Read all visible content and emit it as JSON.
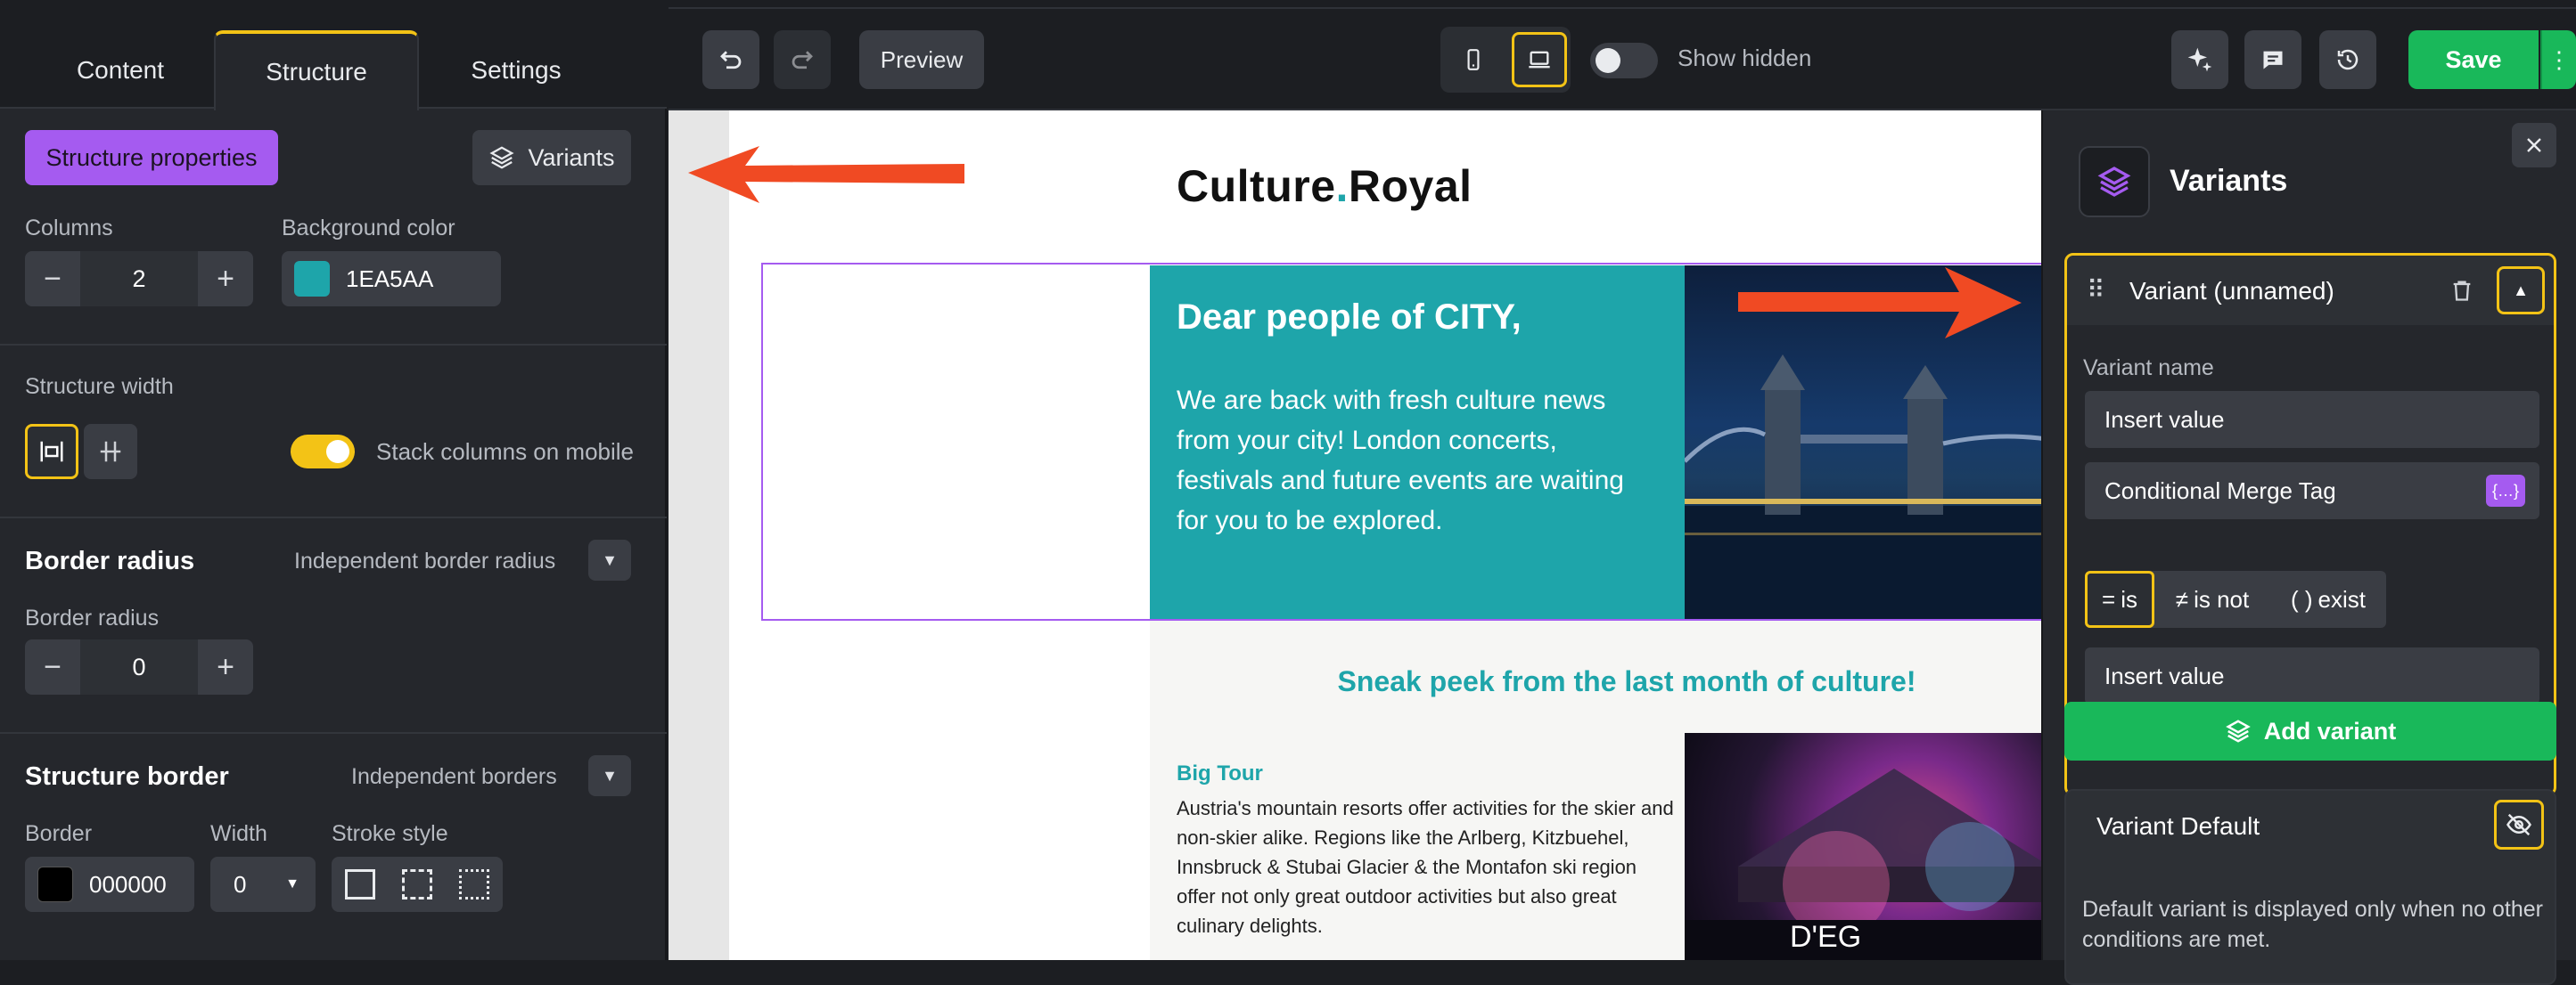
{
  "left_panel": {
    "tabs": [
      "Content",
      "Structure",
      "Settings"
    ],
    "structure_properties_label": "Structure properties",
    "variants_label": "Variants",
    "columns_label": "Columns",
    "columns_value": "2",
    "background_color_label": "Background color",
    "background_color_value": "1EA5AA",
    "background_color_hex": "#1EA5AA",
    "structure_width_label": "Structure width",
    "stack_columns_label": "Stack columns on mobile",
    "stack_columns_on": true,
    "border_radius_heading": "Border radius",
    "independent_border_radius_label": "Independent border radius",
    "border_radius_label": "Border radius",
    "border_radius_value": "0",
    "structure_border_heading": "Structure border",
    "independent_borders_label": "Independent borders",
    "border_label": "Border",
    "border_color_value": "000000",
    "border_color_hex": "#000000",
    "width_label": "Width",
    "width_value": "0",
    "stroke_style_label": "Stroke style"
  },
  "toolbar": {
    "preview_label": "Preview",
    "show_hidden_label": "Show hidden",
    "save_label": "Save"
  },
  "email": {
    "logo_part1": "Culture",
    "logo_dot": ".",
    "logo_part2": "Royal",
    "greeting": "Dear people of CITY,",
    "intro": "We are back with fresh culture news from your city! London concerts, festivals and future events are waiting for you to be explored.",
    "sneak_peek": "Sneak peek from the last month of culture!",
    "big_tour_title": "Big Tour",
    "big_tour_body": "Austria's mountain resorts offer activities for the skier and non-skier alike. Regions like the Arlberg, Kitzbuehel, Innsbruck & Stubai Glacier & the Montafon ski region offer not only great outdoor activities but also great culinary delights.",
    "photo2_sign": "D'EG"
  },
  "right_panel": {
    "title": "Variants",
    "variant_header": "Variant (unnamed)",
    "variant_name_label": "Variant name",
    "variant_name_placeholder": "Insert value",
    "merge_tag_label": "Conditional Merge Tag",
    "op_is": "is",
    "op_is_not": "is not",
    "op_exist": "exist",
    "value_placeholder": "Insert value",
    "add_variant_label": "Add variant",
    "default_title": "Variant Default",
    "default_desc": "Default variant is displayed only when no other conditions are met."
  },
  "colors": {
    "accent_yellow": "#F3C316",
    "purple": "#A55BF0",
    "green": "#19B85A",
    "teal": "#1EA5AA",
    "arrow_red": "#F04A23"
  }
}
